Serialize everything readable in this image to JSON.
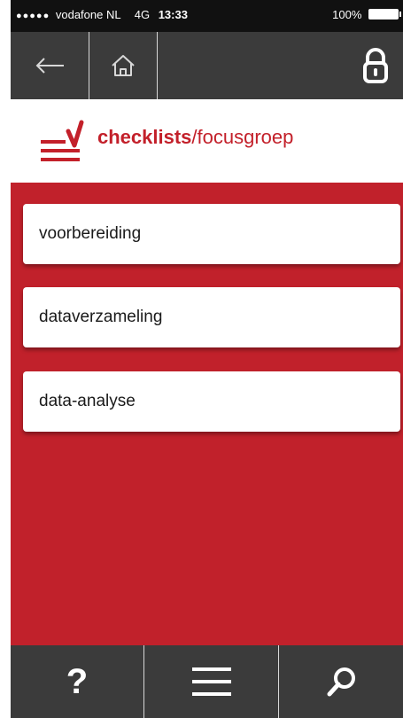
{
  "status_bar": {
    "signal_dots": "●●●●●",
    "carrier": "vodafone NL",
    "network": "4G",
    "time": "13:33",
    "battery": "100%"
  },
  "nav": {
    "back_icon": "arrow-left-icon",
    "home_icon": "home-icon",
    "lock_icon": "padlock-icon"
  },
  "brand": {
    "title_bold": "checklists",
    "title_rest": "/focusgroep",
    "logo_icon": "checklist-logo-icon",
    "accent_color": "#c1212b"
  },
  "checklists": [
    {
      "label": "voorbereiding"
    },
    {
      "label": "dataverzameling"
    },
    {
      "label": "data-analyse"
    }
  ],
  "tabbar": {
    "help_label": "?",
    "menu_icon": "hamburger-menu-icon",
    "search_icon": "search-icon"
  }
}
